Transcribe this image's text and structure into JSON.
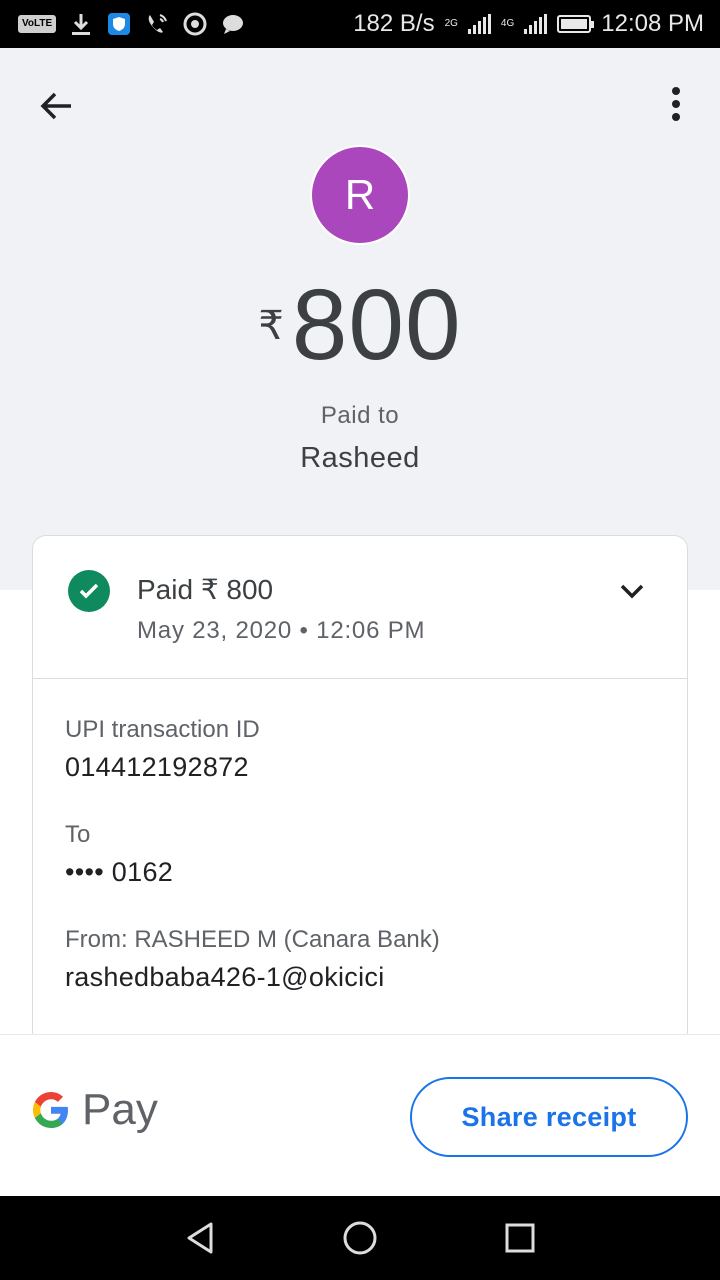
{
  "status_bar": {
    "volte": "VoLTE",
    "speed": "182 B/s",
    "net1": "2G",
    "net2": "4G",
    "time": "12:08 PM",
    "icons": [
      "download-icon",
      "shield-app-icon",
      "wifi-call-icon",
      "chrome-icon",
      "message-icon"
    ]
  },
  "header": {
    "avatar_letter": "R",
    "avatar_color": "#ab47bc",
    "currency_symbol": "₹",
    "amount": "800",
    "paid_to_label": "Paid to",
    "payee_name": "Rasheed"
  },
  "card": {
    "status_title": "Paid ₹ 800",
    "status_date": "May 23, 2020 • 12:06 PM",
    "status_color": "#0f8a5f",
    "details": [
      {
        "label": "UPI transaction ID",
        "value": "014412192872"
      },
      {
        "label": "To",
        "value": "•••• 0162"
      },
      {
        "label": "From: RASHEED M (Canara Bank)",
        "value": "rashedbaba426-1@okicici"
      }
    ]
  },
  "bottom": {
    "brand": "Pay",
    "share_label": "Share receipt",
    "accent": "#1a73e8"
  }
}
